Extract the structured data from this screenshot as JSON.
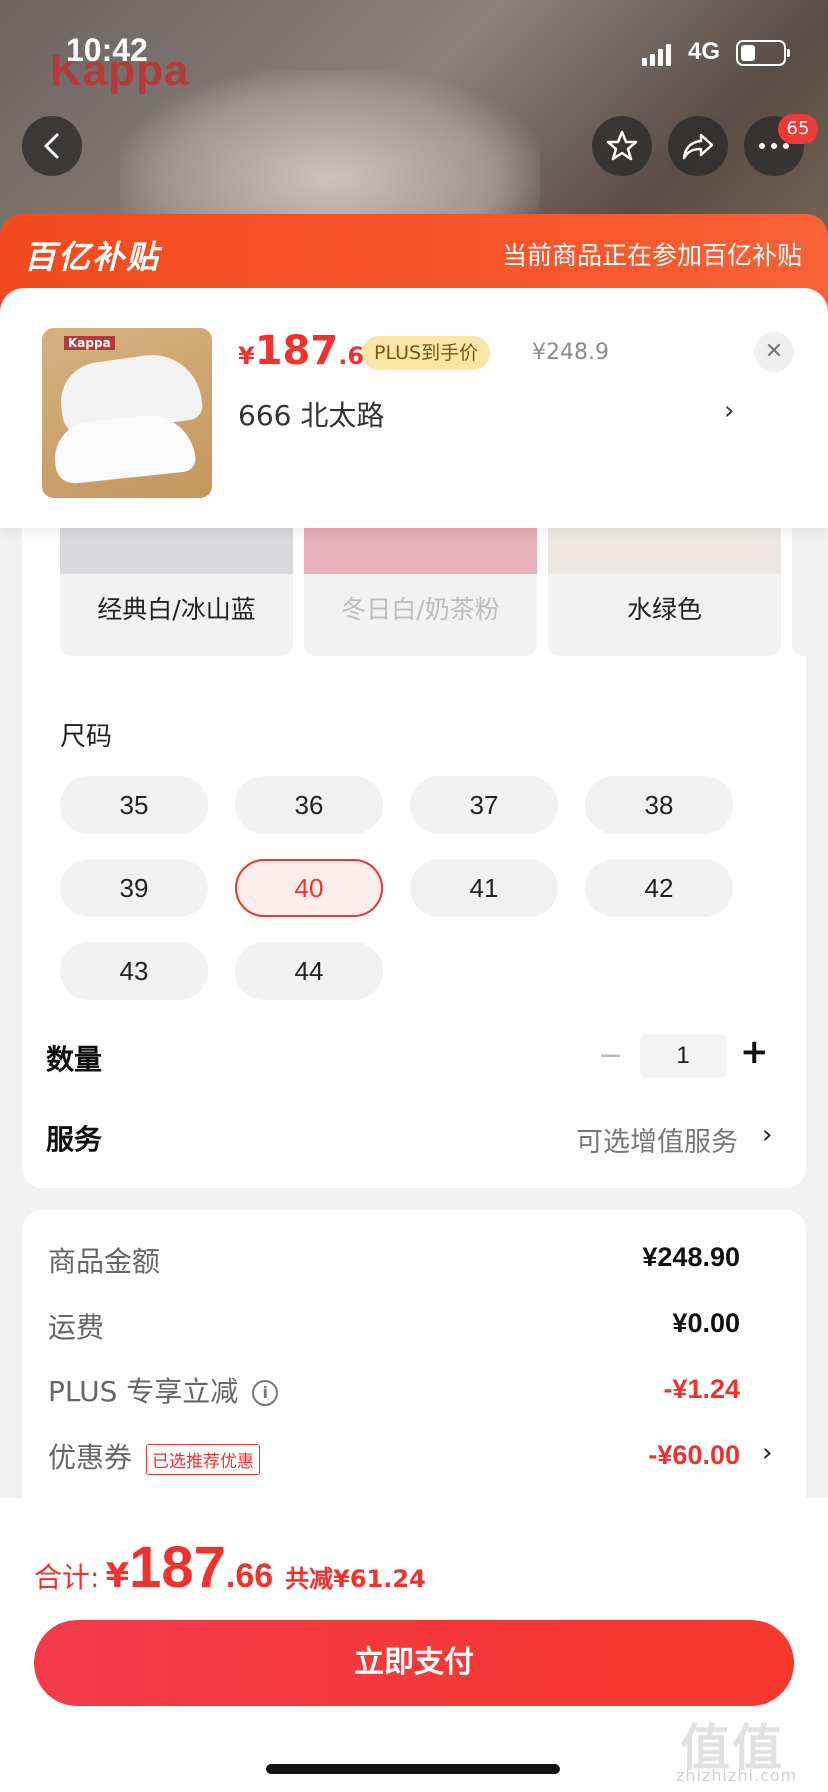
{
  "status_bar": {
    "time": "10:42",
    "network": "4G"
  },
  "hero": {
    "brand": "Kappa",
    "cart_badge": "65"
  },
  "subsidy": {
    "logo": "百亿补贴",
    "info": "当前商品正在参加百亿补贴"
  },
  "product": {
    "thumb_brand": "Kappa",
    "price": {
      "currency": "¥",
      "integer": "187",
      "decimal": ".66"
    },
    "plus_tag": "PLUS到手价",
    "original_price": "¥248.9",
    "address": "666  北太路",
    "close_symbol": "✕"
  },
  "colors": [
    {
      "label": "经典白/冰山蓝",
      "disabled": false,
      "swatch": "#d9d9de"
    },
    {
      "label": "冬日白/奶茶粉",
      "disabled": true,
      "swatch": "#e8b0b8"
    },
    {
      "label": "水绿色",
      "disabled": false,
      "swatch": "#ece7e2"
    }
  ],
  "sizes": {
    "title": "尺码",
    "options": [
      "35",
      "36",
      "37",
      "38",
      "39",
      "40",
      "41",
      "42",
      "43",
      "44"
    ],
    "selected": "40"
  },
  "quantity": {
    "label": "数量",
    "value": "1",
    "minus": "−",
    "plus": "+"
  },
  "service": {
    "label": "服务",
    "value": "可选增值服务"
  },
  "summary": {
    "goods_label": "商品金额",
    "goods_value": "¥248.90",
    "shipping_label": "运费",
    "shipping_value": "¥0.00",
    "plus_label": "PLUS 专享立减",
    "plus_value": "-¥1.24",
    "coupon_label": "优惠券",
    "coupon_tag": "已选推荐优惠",
    "coupon_value": "-¥60.00"
  },
  "bottom": {
    "total_label": "合计:",
    "currency": "¥",
    "total_integer": "187",
    "total_decimal": ".66",
    "saved": "共减¥61.24",
    "pay_button": "立即支付"
  },
  "watermark": {
    "text": "值值值",
    "url": "zhizhizhi.com"
  },
  "colors_accent": {
    "red": "#f0322f",
    "subsidy": "#f24a1e"
  }
}
